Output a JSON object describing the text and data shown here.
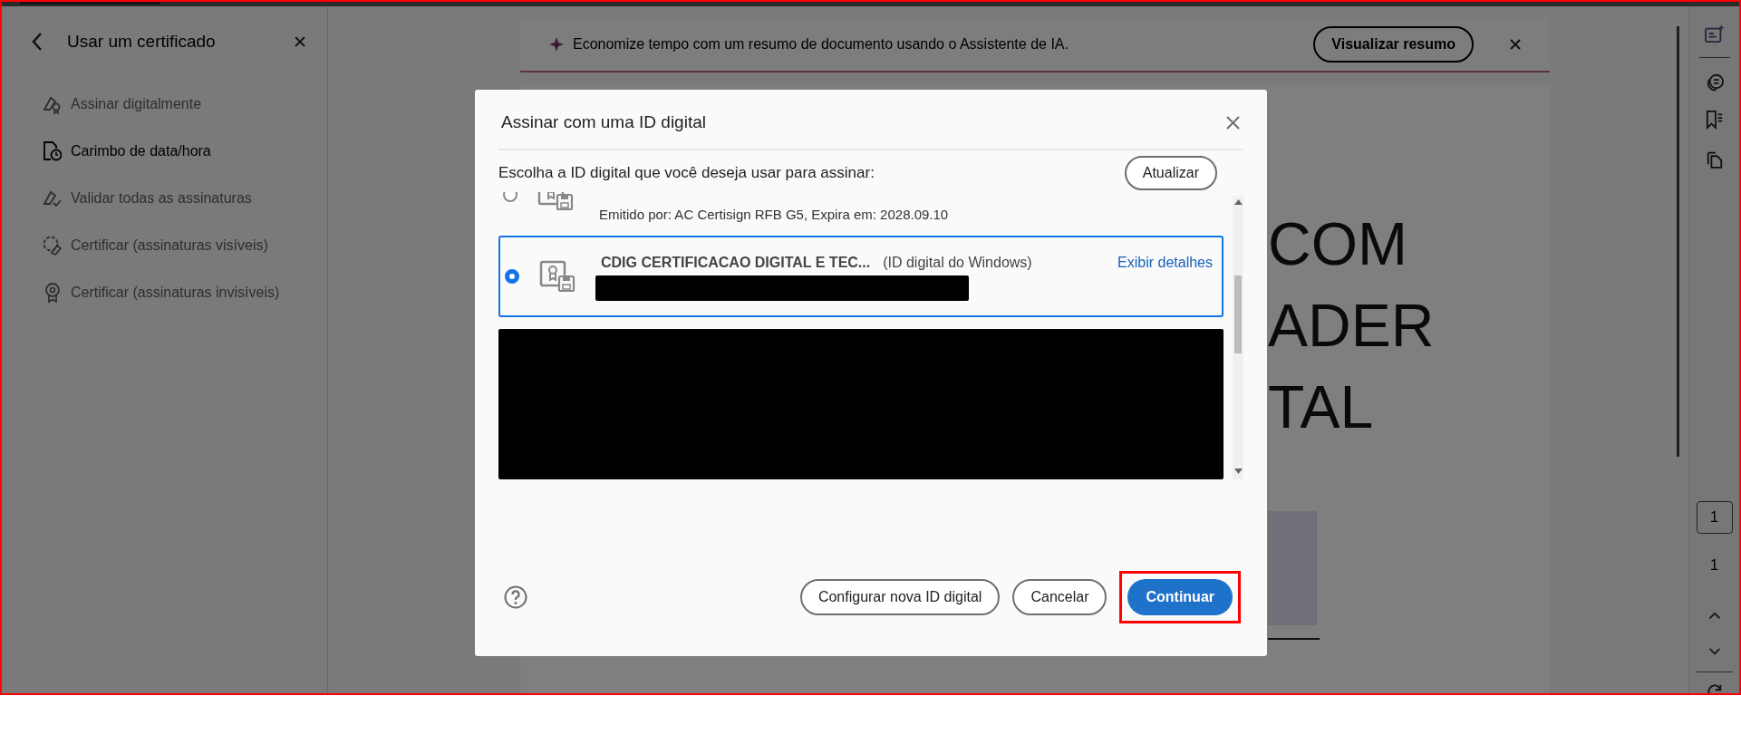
{
  "sidebar": {
    "title": "Usar um certificado",
    "items": [
      {
        "label": "Assinar digitalmente",
        "disabled": true
      },
      {
        "label": "Carimbo de data/hora",
        "disabled": false
      },
      {
        "label": "Validar todas as assinaturas",
        "disabled": true
      },
      {
        "label": "Certificar (assinaturas visíveis)",
        "disabled": true
      },
      {
        "label": "Certificar (assinaturas invisíveis)",
        "disabled": true
      }
    ]
  },
  "banner": {
    "text": "Economize tempo com um resumo de documento usando o Assistente de IA.",
    "button": "Visualizar resumo"
  },
  "document": {
    "lines": [
      "COM",
      "ADER",
      "TAL"
    ]
  },
  "right_toolbar": {
    "page_current": "1",
    "page_total": "1"
  },
  "dialog": {
    "title": "Assinar com uma ID digital",
    "prompt": "Escolha a ID digital que você deseja usar para assinar:",
    "refresh_button": "Atualizar",
    "certificates": [
      {
        "kind": "partial",
        "issuer": "Emitido por: AC Certisign RFB G5, Expira em: 2028.09.10",
        "selected": false
      },
      {
        "kind": "certificate",
        "name": "CDIG CERTIFICACAO DIGITAL E TEC...",
        "type": "(ID digital do Windows)",
        "link": "Exibir detalhes",
        "selected": true,
        "redacted": true
      },
      {
        "kind": "redacted"
      }
    ],
    "buttons": [
      {
        "label": "Configurar nova ID digital",
        "kind": "secondary",
        "highlighted": false
      },
      {
        "label": "Cancelar",
        "kind": "secondary",
        "highlighted": false
      },
      {
        "label": "Continuar",
        "kind": "primary",
        "highlighted": true
      }
    ]
  }
}
